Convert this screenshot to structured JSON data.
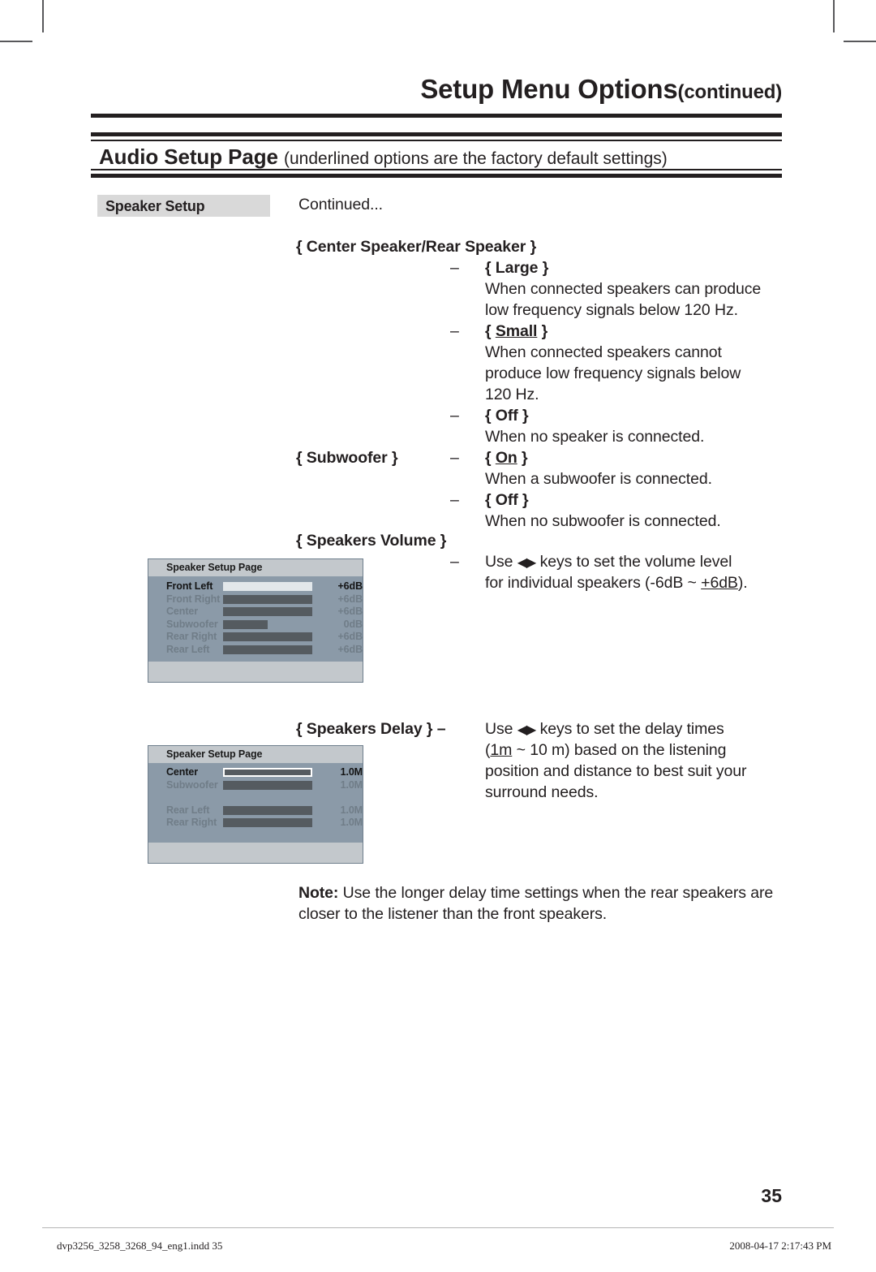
{
  "header": {
    "chapter_title": "Setup Menu Options",
    "chapter_title_continued": "(continued)",
    "section_title": "Audio Setup Page",
    "section_subtitle": "(underlined options are the factory default settings)"
  },
  "left_label": {
    "text": "Speaker Setup"
  },
  "body": {
    "continued": "Continued...",
    "center_rear_heading": "{ Center Speaker/Rear Speaker }",
    "large_option": "{ Large }",
    "large_desc_line1": "When connected speakers can produce",
    "large_desc_line2": "low frequency signals below 120 Hz.",
    "small_option_open": "{ ",
    "small_option_word": "Small",
    "small_option_close": " }",
    "small_desc_line1": "When connected speakers cannot",
    "small_desc_line2": "produce low frequency signals below",
    "small_desc_line3": "120 Hz.",
    "off_option": "{ Off }",
    "off_desc": "When no speaker is connected.",
    "subwoofer_heading": "{ Subwoofer }",
    "on_option_open": "{ ",
    "on_option_word": "On",
    "on_option_close": " }",
    "on_desc": "When a subwoofer is connected.",
    "sub_off_option": "{ Off }",
    "sub_off_desc": "When no subwoofer is connected.",
    "speakers_volume_heading": "{ Speakers Volume }",
    "volume_desc_line1_pre": "Use ",
    "volume_desc_arrows": "◀▶",
    "volume_desc_line1_post": " keys to set the volume level",
    "volume_desc_line2_pre": "for individual speakers (-6dB ~ ",
    "volume_desc_line2_underline": "+6dB",
    "volume_desc_line2_post": ").",
    "speakers_delay_heading": "{ Speakers Delay } –",
    "delay_desc_line1_pre": "Use ",
    "delay_desc_arrows": "◀▶",
    "delay_desc_line1_post": " keys to set the delay times",
    "delay_desc_line2_open": "(",
    "delay_desc_line2_underline": "1m",
    "delay_desc_line2_rest": " ~ 10 m) based on the listening",
    "delay_desc_line3": "position and distance to best suit your",
    "delay_desc_line4": "surround needs.",
    "dash": "–",
    "note_label": "Note:",
    "note_text": " Use the longer delay time settings when the rear speakers are closer to the listener than the front speakers."
  },
  "osd_volume": {
    "title": "Speaker Setup Page",
    "rows": [
      {
        "label": "Front Left",
        "value": "+6dB",
        "bar_pct": 100,
        "selected": true
      },
      {
        "label": "Front Right",
        "value": "+6dB",
        "bar_pct": 100,
        "selected": false
      },
      {
        "label": "Center",
        "value": "+6dB",
        "bar_pct": 100,
        "selected": false
      },
      {
        "label": "Subwoofer",
        "value": "0dB",
        "bar_pct": 50,
        "selected": false
      },
      {
        "label": "Rear Right",
        "value": "+6dB",
        "bar_pct": 100,
        "selected": false
      },
      {
        "label": "Rear Left",
        "value": "+6dB",
        "bar_pct": 100,
        "selected": false
      }
    ]
  },
  "osd_delay": {
    "title": "Speaker Setup Page",
    "rows": [
      {
        "label": "Center",
        "value": "1.0M",
        "bar_pct": 100,
        "selected": true
      },
      {
        "label": "Subwoofer",
        "value": "1.0M",
        "bar_pct": 100,
        "selected": false
      },
      {
        "label": "",
        "value": "",
        "bar_pct": 0,
        "selected": false
      },
      {
        "label": "Rear Left",
        "value": "1.0M",
        "bar_pct": 100,
        "selected": false
      },
      {
        "label": "Rear Right",
        "value": "1.0M",
        "bar_pct": 100,
        "selected": false
      }
    ]
  },
  "footer": {
    "page_number": "35",
    "file_name": "dvp3256_3258_3268_94_eng1.indd   35",
    "timestamp": "2008-04-17   2:17:43 PM"
  },
  "colors": {
    "ink": "#231f20",
    "left_box_bg": "#d9d9d9",
    "osd_bg": "#8b9aa8",
    "osd_title_bg": "#c3c8cc",
    "osd_bar": "#555b60",
    "osd_bar_selected": "#e2e7ea",
    "osd_label_dim": "#707d88"
  }
}
